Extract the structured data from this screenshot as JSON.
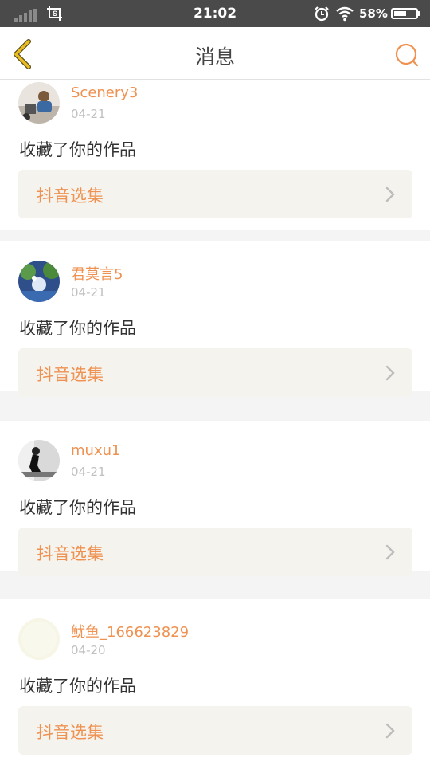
{
  "status_bar": {
    "time": "21:02",
    "battery": "58%",
    "battery_level": 0.58,
    "icons": [
      "signal-icon",
      "screenshot-icon",
      "alarm-icon",
      "wifi-icon",
      "battery-icon"
    ]
  },
  "header": {
    "title": "消息",
    "back_icon": "chevron-left-icon",
    "search_icon": "search-icon"
  },
  "colors": {
    "accent": "#ef9150",
    "back_icon": "#e0b21e",
    "tag_bg": "#f4f3ee",
    "text": "#333333",
    "muted": "#c0c0c0"
  },
  "messages": [
    {
      "user": "Scenery3",
      "date": "04-21",
      "action": "收藏了你的作品",
      "collection": "抖音选集"
    },
    {
      "user": "君莫言5",
      "date": "04-21",
      "action": "收藏了你的作品",
      "collection": "抖音选集"
    },
    {
      "user": "muxu1",
      "date": "04-21",
      "action": "收藏了你的作品",
      "collection": "抖音选集"
    },
    {
      "user": "鱿鱼_166623829",
      "date": "04-20",
      "action": "收藏了你的作品",
      "collection": "抖音选集"
    }
  ]
}
